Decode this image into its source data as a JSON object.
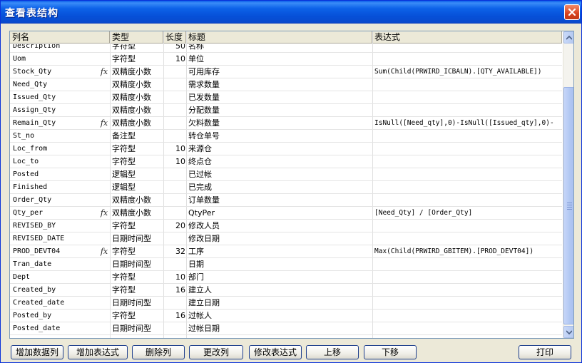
{
  "window": {
    "title": "查看表结构"
  },
  "columns": {
    "name": "列名",
    "type": "类型",
    "length": "长度",
    "title": "标题",
    "expression": "表达式"
  },
  "fx_label": "fx",
  "rows": [
    {
      "name": "Description",
      "fx": false,
      "type": "字符型",
      "length": "50",
      "title": "名称",
      "expr": ""
    },
    {
      "name": "Uom",
      "fx": false,
      "type": "字符型",
      "length": "10",
      "title": "单位",
      "expr": ""
    },
    {
      "name": "Stock_Qty",
      "fx": true,
      "type": "双精度小数",
      "length": "",
      "title": "可用库存",
      "expr": "Sum(Child(PRWIRD_ICBALN).[QTY_AVAILABLE])"
    },
    {
      "name": "Need_Qty",
      "fx": false,
      "type": "双精度小数",
      "length": "",
      "title": "需求数量",
      "expr": ""
    },
    {
      "name": "Issued_Qty",
      "fx": false,
      "type": "双精度小数",
      "length": "",
      "title": "已发数量",
      "expr": ""
    },
    {
      "name": "Assign_Qty",
      "fx": false,
      "type": "双精度小数",
      "length": "",
      "title": "分配数量",
      "expr": ""
    },
    {
      "name": "Remain_Qty",
      "fx": true,
      "type": "双精度小数",
      "length": "",
      "title": "欠料数量",
      "expr": "IsNull([Need_qty],0)-IsNull([Issued_qty],0)-"
    },
    {
      "name": "St_no",
      "fx": false,
      "type": "备注型",
      "length": "",
      "title": "转仓单号",
      "expr": ""
    },
    {
      "name": "Loc_from",
      "fx": false,
      "type": "字符型",
      "length": "10",
      "title": "来源仓",
      "expr": ""
    },
    {
      "name": "Loc_to",
      "fx": false,
      "type": "字符型",
      "length": "10",
      "title": "终点仓",
      "expr": ""
    },
    {
      "name": "Posted",
      "fx": false,
      "type": "逻辑型",
      "length": "",
      "title": "已过帐",
      "expr": ""
    },
    {
      "name": "Finished",
      "fx": false,
      "type": "逻辑型",
      "length": "",
      "title": "已完成",
      "expr": ""
    },
    {
      "name": "Order_Qty",
      "fx": false,
      "type": "双精度小数",
      "length": "",
      "title": "订单数量",
      "expr": ""
    },
    {
      "name": "Qty_per",
      "fx": true,
      "type": "双精度小数",
      "length": "",
      "title": "QtyPer",
      "expr": "[Need_Qty] / [Order_Qty]"
    },
    {
      "name": "REVISED_BY",
      "fx": false,
      "type": "字符型",
      "length": "20",
      "title": "修改人员",
      "expr": ""
    },
    {
      "name": "REVISED_DATE",
      "fx": false,
      "type": "日期时间型",
      "length": "",
      "title": "修改日期",
      "expr": ""
    },
    {
      "name": "PROD_DEVT04",
      "fx": true,
      "type": "字符型",
      "length": "32",
      "title": "工序",
      "expr": "Max(Child(PRWIRD_GBITEM).[PROD_DEVT04])"
    },
    {
      "name": "Tran_date",
      "fx": false,
      "type": "日期时间型",
      "length": "",
      "title": "日期",
      "expr": ""
    },
    {
      "name": "Dept",
      "fx": false,
      "type": "字符型",
      "length": "10",
      "title": "部门",
      "expr": ""
    },
    {
      "name": "Created_by",
      "fx": false,
      "type": "字符型",
      "length": "16",
      "title": "建立人",
      "expr": ""
    },
    {
      "name": "Created_date",
      "fx": false,
      "type": "日期时间型",
      "length": "",
      "title": "建立日期",
      "expr": ""
    },
    {
      "name": "Posted_by",
      "fx": false,
      "type": "字符型",
      "length": "16",
      "title": "过帐人",
      "expr": ""
    },
    {
      "name": "Posted_date",
      "fx": false,
      "type": "日期时间型",
      "length": "",
      "title": "过帐日期",
      "expr": ""
    }
  ],
  "buttons": {
    "add_data_column": "增加数据列",
    "add_expression": "增加表达式",
    "delete_column": "删除列",
    "change_column": "更改列",
    "edit_expression": "修改表达式",
    "move_up": "上移",
    "move_down": "下移",
    "print": "打印"
  },
  "colors": {
    "title_bar": "#0a5ce8",
    "close_button": "#d8421e",
    "grid_border": "#7f9db9",
    "dialog_bg": "#ece9d8"
  }
}
